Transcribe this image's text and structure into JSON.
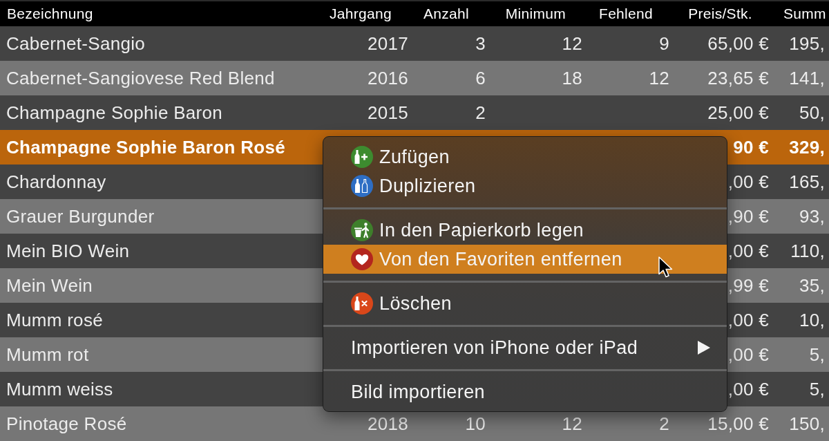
{
  "table": {
    "columns": [
      "Bezeichnung",
      "Jahrgang",
      "Anzahl",
      "Minimum",
      "Fehlend",
      "Preis/Stk.",
      "Summ"
    ],
    "rows": [
      {
        "bezeichnung": "Cabernet-Sangio",
        "jahrgang": "2017",
        "anzahl": "3",
        "minimum": "12",
        "fehlend": "9",
        "preis_stk": "65,00 €",
        "summ": "195,",
        "selected": false
      },
      {
        "bezeichnung": "Cabernet-Sangiovese Red Blend",
        "jahrgang": "2016",
        "anzahl": "6",
        "minimum": "18",
        "fehlend": "12",
        "preis_stk": "23,65 €",
        "summ": "141,",
        "selected": false
      },
      {
        "bezeichnung": "Champagne Sophie Baron",
        "jahrgang": "2015",
        "anzahl": "2",
        "preis_stk": "25,00 €",
        "summ": "50,",
        "selected": false
      },
      {
        "bezeichnung": "Champagne Sophie Baron Rosé",
        "preis_stk": "90 €",
        "summ": "329,",
        "selected": true
      },
      {
        "bezeichnung": "Chardonnay",
        "preis_stk": ",00 €",
        "summ": "165,",
        "selected": false
      },
      {
        "bezeichnung": "Grauer Burgunder",
        "preis_stk": ",90 €",
        "summ": "93,",
        "selected": false
      },
      {
        "bezeichnung": "Mein BIO Wein",
        "preis_stk": ",00 €",
        "summ": "110,",
        "selected": false
      },
      {
        "bezeichnung": "Mein Wein",
        "preis_stk": ",99 €",
        "summ": "35,",
        "selected": false
      },
      {
        "bezeichnung": "Mumm rosé",
        "preis_stk": ",00 €",
        "summ": "10,",
        "selected": false
      },
      {
        "bezeichnung": "Mumm rot",
        "preis_stk": ",00 €",
        "summ": "5,",
        "selected": false
      },
      {
        "bezeichnung": "Mumm weiss",
        "preis_stk": ",00 €",
        "summ": "5,",
        "selected": false
      },
      {
        "bezeichnung": "Pinotage Rosé",
        "jahrgang": "2018",
        "anzahl": "10",
        "minimum": "12",
        "fehlend": "2",
        "preis_stk": "15,00 €",
        "summ": "150,",
        "selected": false
      }
    ]
  },
  "menu": {
    "sections": [
      {
        "items": [
          {
            "label": "Zufügen",
            "kind": "add",
            "selected": false,
            "submenu": false
          },
          {
            "label": "Duplizieren",
            "kind": "duplicate",
            "selected": false,
            "submenu": false
          }
        ]
      },
      {
        "items": [
          {
            "label": "In den Papierkorb legen",
            "kind": "trash",
            "selected": false,
            "submenu": false
          },
          {
            "label": "Von den Favoriten entfernen",
            "kind": "favorite",
            "selected": true,
            "submenu": false
          }
        ]
      },
      {
        "items": [
          {
            "label": "Löschen",
            "kind": "delete",
            "selected": false,
            "submenu": false
          }
        ]
      },
      {
        "items": [
          {
            "label": "Importieren von iPhone oder iPad",
            "kind": "plain",
            "selected": false,
            "submenu": true
          }
        ]
      },
      {
        "items": [
          {
            "label": "Bild importieren",
            "kind": "plain",
            "selected": false,
            "submenu": false
          }
        ]
      }
    ]
  }
}
